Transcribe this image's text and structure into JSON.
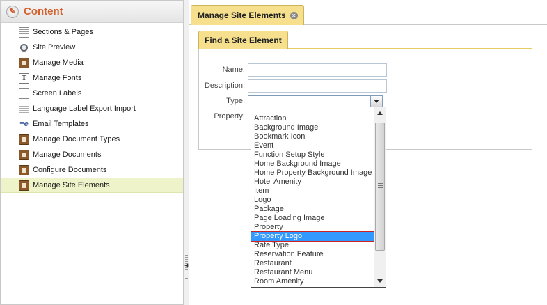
{
  "sidebar": {
    "title": "Content",
    "items": [
      {
        "label": "Sections & Pages",
        "icon": "page-icon"
      },
      {
        "label": "Site Preview",
        "icon": "magnifier-icon"
      },
      {
        "label": "Manage Media",
        "icon": "media-icon"
      },
      {
        "label": "Manage Fonts",
        "icon": "font-icon"
      },
      {
        "label": "Screen Labels",
        "icon": "page-icon"
      },
      {
        "label": "Language Label Export Import",
        "icon": "export-icon"
      },
      {
        "label": "Email Templates",
        "icon": "email-icon"
      },
      {
        "label": "Manage Document Types",
        "icon": "document-type-icon"
      },
      {
        "label": "Manage Documents",
        "icon": "document-icon"
      },
      {
        "label": "Configure Documents",
        "icon": "configure-icon"
      },
      {
        "label": "Manage Site Elements",
        "icon": "site-elements-icon",
        "active": true
      }
    ]
  },
  "main_tab": {
    "label": "Manage Site Elements"
  },
  "panel": {
    "title": "Find a Site Element"
  },
  "form": {
    "name_label": "Name:",
    "name_value": "",
    "description_label": "Description:",
    "description_value": "",
    "type_label": "Type:",
    "type_value": "",
    "property_label": "Property:"
  },
  "type_options": [
    "",
    "Attraction",
    "Background Image",
    "Bookmark Icon",
    "Event",
    "Function Setup Style",
    "Home Background Image",
    "Home Property Background Image",
    "Hotel Amenity",
    "Item",
    "Logo",
    "Package",
    "Page Loading Image",
    "Property",
    "Property Logo",
    "Rate Type",
    "Reservation Feature",
    "Restaurant",
    "Restaurant Menu",
    "Room Amenity"
  ],
  "selected_option": "Property Logo",
  "colors": {
    "accent_tab": "#f6e08e",
    "header_text": "#d4602d",
    "active_nav": "#eef3c9",
    "selection": "#3399ff",
    "highlight_border": "#cc2222"
  }
}
